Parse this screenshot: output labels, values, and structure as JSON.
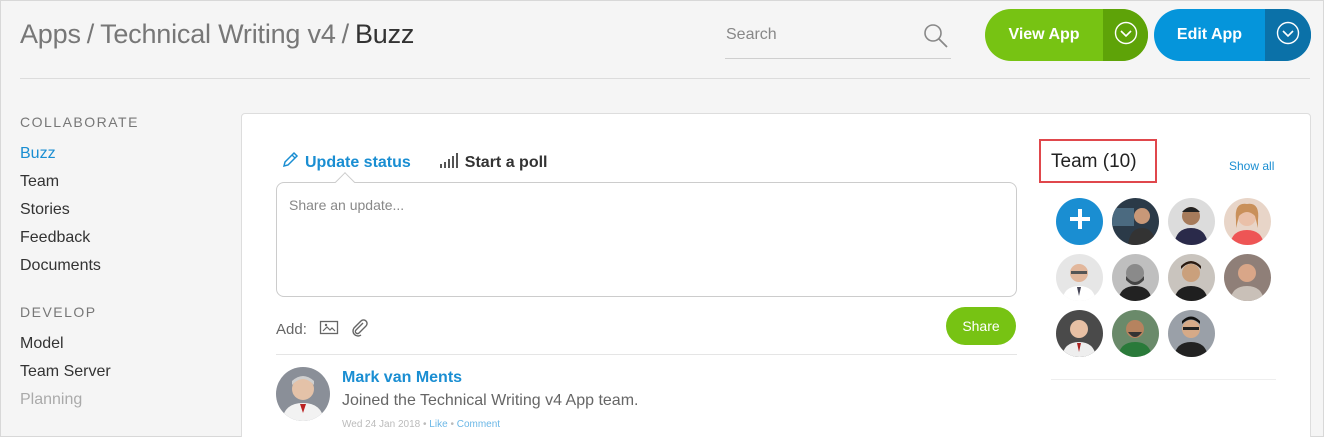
{
  "breadcrumb": {
    "part1": "Apps",
    "part2": "Technical Writing v4",
    "part3": "Buzz",
    "separator": "/"
  },
  "search": {
    "placeholder": "Search",
    "icon": "search-icon"
  },
  "buttons": {
    "view_app": {
      "label": "View App",
      "icon": "chevron-down-circle-icon",
      "color": "#77c313"
    },
    "edit_app": {
      "label": "Edit App",
      "icon": "chevron-down-circle-icon",
      "color": "#0595db"
    }
  },
  "sidebar": {
    "sections": [
      {
        "heading": "COLLABORATE",
        "items": [
          {
            "label": "Buzz",
            "state": "active"
          },
          {
            "label": "Team"
          },
          {
            "label": "Stories"
          },
          {
            "label": "Feedback"
          },
          {
            "label": "Documents"
          }
        ]
      },
      {
        "heading": "DEVELOP",
        "items": [
          {
            "label": "Model"
          },
          {
            "label": "Team Server"
          },
          {
            "label": "Planning",
            "state": "muted"
          }
        ]
      }
    ]
  },
  "composer": {
    "tabs": [
      {
        "label": "Update status",
        "icon": "pencil-icon"
      },
      {
        "label": "Start a poll",
        "icon": "bar-chart-icon"
      }
    ],
    "placeholder": "Share an update...",
    "add_label": "Add:",
    "share_label": "Share"
  },
  "feed": {
    "items": [
      {
        "author": "Mark van Ments",
        "text": "Joined the Technical Writing v4 App team.",
        "date": "Wed 24 Jan 2018",
        "bullet": "•",
        "like": "Like",
        "comment": "Comment"
      }
    ]
  },
  "team": {
    "title": "Team (10)",
    "show_all": "Show all",
    "member_count": 10
  },
  "colors": {
    "accent_blue": "#1a8ed2",
    "accent_green": "#77c313",
    "highlight_red": "#e0474c"
  }
}
